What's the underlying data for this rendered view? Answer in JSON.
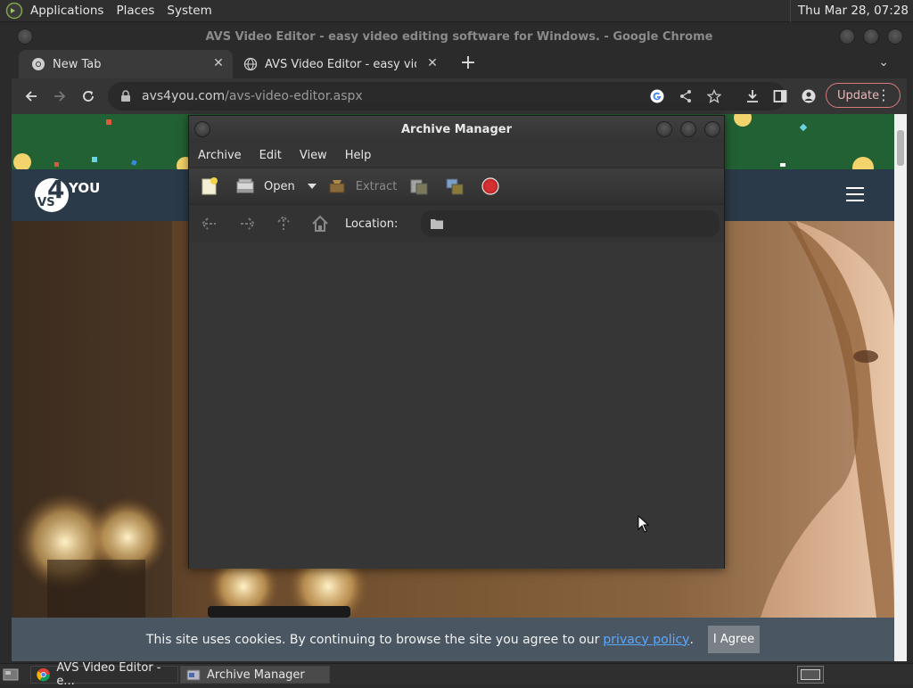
{
  "top_panel": {
    "menus": [
      "Applications",
      "Places",
      "System"
    ],
    "clock": "Thu Mar 28, 07:28"
  },
  "chrome": {
    "window_title": "AVS Video Editor - easy video editing software for Windows. - Google Chrome",
    "tabs": [
      {
        "label": "New Tab"
      },
      {
        "label": "AVS Video Editor - easy video"
      }
    ],
    "url_domain": "avs4you.com",
    "url_path": "/avs-video-editor.aspx",
    "update_label": "Update"
  },
  "page": {
    "logo_text": "4",
    "logo_sub": "YOU",
    "logo_prefix": "AVS",
    "cookie_text": "This site uses cookies. By continuing to browse the site you agree to our",
    "cookie_link": "privacy policy",
    "cookie_period": ".",
    "agree_label": "I Agree"
  },
  "archive_manager": {
    "title": "Archive Manager",
    "menus": [
      "Archive",
      "Edit",
      "View",
      "Help"
    ],
    "toolbar": {
      "open_label": "Open",
      "extract_label": "Extract"
    },
    "location_label": "Location:"
  },
  "taskbar": {
    "tasks": [
      {
        "label": "AVS Video Editor - e..."
      },
      {
        "label": "Archive Manager"
      }
    ]
  },
  "colors": {
    "confetti_band": "#226133",
    "header_bg": "#2b3a48",
    "cookie_bar": "#4a5763",
    "link": "#5aa8ff"
  }
}
